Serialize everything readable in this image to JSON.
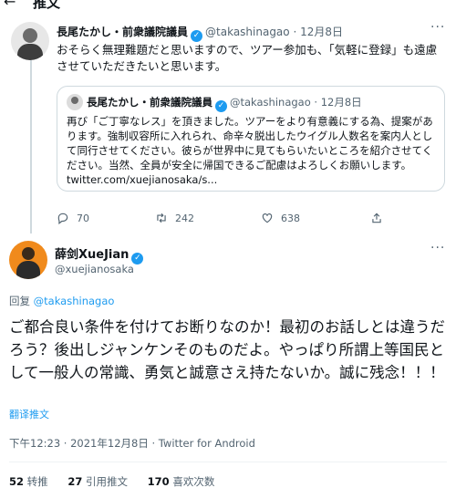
{
  "header": {
    "title": "推文"
  },
  "parent_tweet": {
    "name": "長尾たかし・前衆議院議員",
    "handle": "@takashinagao",
    "separator": "·",
    "date": "12月8日",
    "text": "おそらく無理難題だと思いますので、ツアー参加も、「気軽に登録」も遠慮させていただきたいと思います。",
    "quote": {
      "name": "長尾たかし・前衆議院議員",
      "handle": "@takashinagao",
      "separator": "·",
      "date": "12月8日",
      "text": "再び「ご丁寧なレス」を頂きました。ツアーをより有意義にする為、提案があります。強制収容所に入れられ、命辛々脱出したウイグル人数名を案内人として同行させてください。彼らが世界中に見てもらいたいところを紹介させてください。当然、全員が安全に帰国できるご配慮はよろしくお願いします。 twitter.com/xuejianosaka/s..."
    },
    "actions": {
      "reply_count": "70",
      "retweet_count": "242",
      "like_count": "638"
    }
  },
  "main_tweet": {
    "name": "薛剑XueJian",
    "handle": "@xuejianosaka",
    "reply_prefix": "回复",
    "reply_to": "@takashinagao",
    "text": "ご都合良い条件を付けてお断りなのか！最初のお話しとは違うだろう？後出しジャンケンそのものだよ。やっぱり所謂上等国民として一般人の常識、勇気と誠意さえ持たないか。誠に残念！！！",
    "translate_label": "翻译推文",
    "timestamp": "下午12:23 · 2021年12月8日 · Twitter for Android",
    "stats": {
      "retweets_count": "52",
      "retweets_label": "转推",
      "quotes_count": "27",
      "quotes_label": "引用推文",
      "likes_count": "170",
      "likes_label": "喜欢次数"
    }
  },
  "colors": {
    "accent": "#1d9bf0",
    "muted": "#536471",
    "border": "#cfd9de",
    "text": "#0f1419"
  },
  "icons": [
    "back-arrow-icon",
    "verified-badge-icon",
    "more-icon",
    "reply-icon",
    "retweet-icon",
    "like-icon",
    "share-icon"
  ]
}
